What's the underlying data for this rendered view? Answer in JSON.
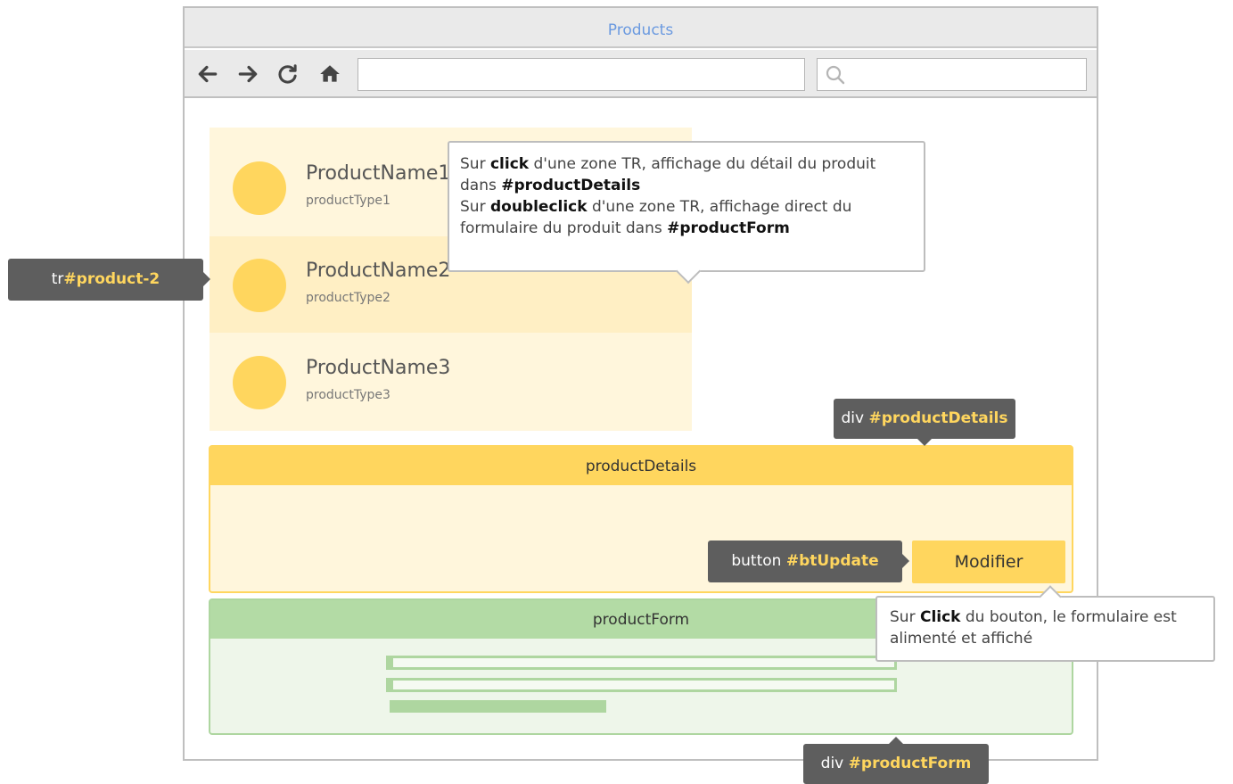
{
  "window": {
    "title": "Products"
  },
  "toolbar": {
    "back_icon": "arrow-left-icon",
    "forward_icon": "arrow-right-icon",
    "reload_icon": "reload-icon",
    "home_icon": "home-icon",
    "url_value": "",
    "search_value": "",
    "search_icon": "search-icon"
  },
  "products": [
    {
      "name": "ProductName1",
      "type": "productType1"
    },
    {
      "name": "ProductName2",
      "type": "productType2",
      "selected": true
    },
    {
      "name": "ProductName3",
      "type": "productType3"
    }
  ],
  "tip1": {
    "l1_a": "Sur ",
    "l1_b": "click",
    "l1_c": " d'une zone TR, affichage du détail du produit",
    "l2_a": "dans ",
    "l2_b": "#productDetails",
    "l3_a": "Sur ",
    "l3_b": "doubleclick",
    "l3_c": " d'une zone TR, affichage direct du",
    "l4_a": "formulaire du produit dans ",
    "l4_b": "#productForm"
  },
  "labels": {
    "tr_prefix": "tr",
    "tr_id": "#product-2",
    "details_prefix": "div ",
    "details_id": "#productDetails",
    "button_prefix": "button ",
    "button_id": "#btUpdate",
    "form_prefix": "div ",
    "form_id": "#productForm"
  },
  "productDetails": {
    "title": "productDetails",
    "button_label": "Modifier"
  },
  "productForm": {
    "title": "productForm"
  },
  "tip2": {
    "l1_a": "Sur ",
    "l1_b": "Click",
    "l1_c": " du bouton, le formulaire est",
    "l2": "alimenté et affiché"
  },
  "colors": {
    "accent": "#ffd65e",
    "form_green": "#b3dba5",
    "label_dark": "#5e5e5e",
    "title_blue": "#6b9ae0"
  }
}
